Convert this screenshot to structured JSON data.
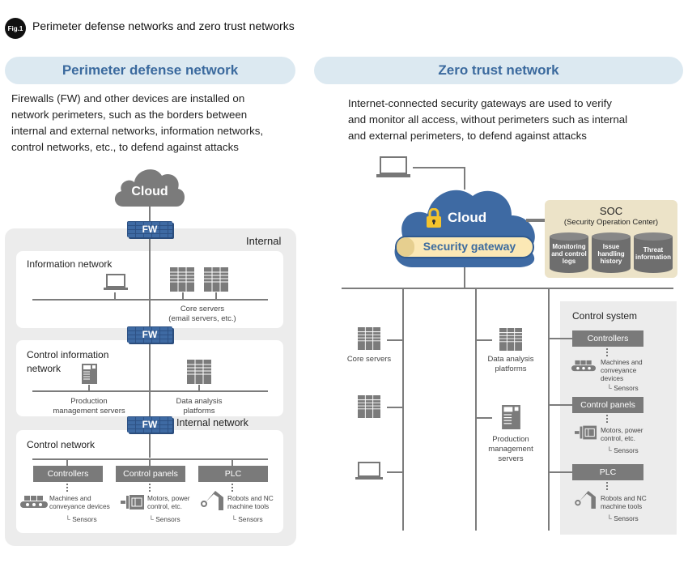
{
  "figure": {
    "badge": "Fig.1",
    "title": "Perimeter defense networks and zero trust networks"
  },
  "perimeter": {
    "heading": "Perimeter defense network",
    "description": [
      "Firewalls (FW) and other devices are installed on",
      "network perimeters, such as the borders between",
      "internal and external networks, information networks,",
      "control networks, etc., to defend against attacks"
    ],
    "cloud_label": "Cloud",
    "firewall_label": "FW",
    "internal_label": "Internal",
    "internal_network_label": "Internal network",
    "information_network": {
      "title": "Information network",
      "servers_caption": [
        "Core servers",
        "(email servers, etc.)"
      ]
    },
    "control_information_network": {
      "title": [
        "Control information",
        "network"
      ],
      "production_caption": [
        "Production",
        "management servers"
      ],
      "analysis_caption": [
        "Data analysis",
        "platforms"
      ]
    },
    "control_network": {
      "title": "Control network",
      "units": [
        {
          "label": "Controllers",
          "device": [
            "Machines and",
            "conveyance devices"
          ],
          "sensor": "Sensors"
        },
        {
          "label": "Control panels",
          "device": [
            "Motors, power",
            "control, etc."
          ],
          "sensor": "Sensors"
        },
        {
          "label": "PLC",
          "device": [
            "Robots and NC",
            "machine tools"
          ],
          "sensor": "Sensors"
        }
      ]
    }
  },
  "zero_trust": {
    "heading": "Zero trust network",
    "description": [
      "Internet-connected security gateways are used to verify",
      "and monitor all access, without perimeters such as internal",
      "and external perimeters, to defend against attacks"
    ],
    "cloud_label": "Cloud",
    "gateway_label": "Security gateway",
    "soc": {
      "title": "SOC",
      "subtitle": "(Security Operation Center)",
      "databases": [
        [
          "Monitoring",
          "and control",
          "logs"
        ],
        [
          "Issue",
          "handling",
          "history"
        ],
        [
          "Threat",
          "information"
        ]
      ]
    },
    "core_servers_caption": "Core servers",
    "analysis_caption": [
      "Data analysis",
      "platforms"
    ],
    "production_caption": [
      "Production",
      "management",
      "servers"
    ],
    "control_system": {
      "title": "Control system",
      "units": [
        {
          "label": "Controllers",
          "device": [
            "Machines and",
            "conveyance",
            "devices"
          ],
          "sensor": "Sensors"
        },
        {
          "label": "Control panels",
          "device": [
            "Motors, power",
            "control, etc."
          ],
          "sensor": "Sensors"
        },
        {
          "label": "PLC",
          "device": [
            "Robots and NC",
            "machine tools"
          ],
          "sensor": "Sensors"
        }
      ]
    }
  },
  "colors": {
    "accent_blue": "#3e6aa3",
    "pill_bg": "#dce9f1",
    "soc_bg": "#ece3c8",
    "gateway_bg": "#fbe8b5",
    "lock_yellow": "#f5c42c",
    "line_gray": "#7c7c7c"
  }
}
